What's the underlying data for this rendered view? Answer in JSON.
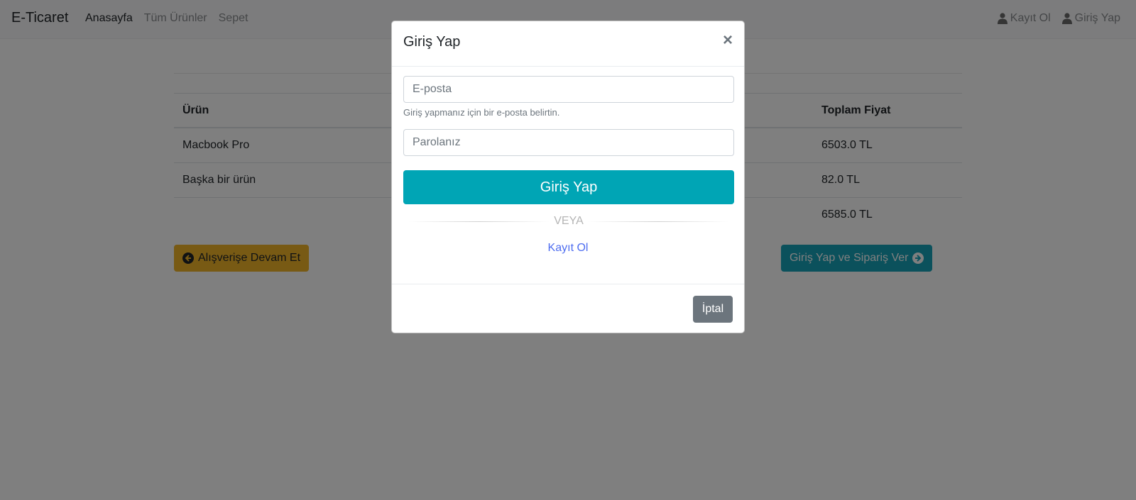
{
  "navbar": {
    "brand": "E-Ticaret",
    "links": [
      {
        "label": "Anasayfa",
        "active": true
      },
      {
        "label": "Tüm Ürünler",
        "active": false
      },
      {
        "label": "Sepet",
        "active": false
      }
    ],
    "right": [
      {
        "label": "Kayıt Ol",
        "icon": "user-icon"
      },
      {
        "label": "Giriş Yap",
        "icon": "user-icon"
      }
    ]
  },
  "cart": {
    "headers": [
      "Ürün",
      "",
      "",
      "Toplam Fiyat"
    ],
    "rows": [
      {
        "product": "Macbook Pro",
        "total": "6503.0 TL"
      },
      {
        "product": "Başka bir ürün",
        "total": "82.0 TL"
      }
    ],
    "grand_total": "6585.0 TL",
    "continue_label": "Alışverişe Devam Et",
    "order_label": "Giriş Yap ve Sipariş Ver"
  },
  "modal": {
    "title": "Giriş Yap",
    "close": "×",
    "email_placeholder": "E-posta",
    "email_help": "Giriş yapmanız için bir e-posta belirtin.",
    "password_placeholder": "Parolanız",
    "login_label": "Giriş Yap",
    "divider_label": "VEYA",
    "register_label": "Kayıt Ol",
    "cancel_label": "İptal"
  },
  "colors": {
    "primary": "#00a5b5",
    "warning": "#f0b429",
    "secondary": "#6c757d",
    "link": "#4e6df0"
  }
}
